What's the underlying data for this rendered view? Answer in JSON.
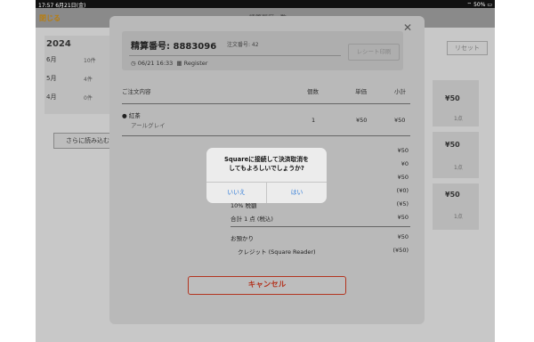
{
  "status": {
    "time": "17:57",
    "date": "6月21日(金)",
    "battery": "50%"
  },
  "header": {
    "close": "閉じる",
    "title": "精算履歴一覧"
  },
  "history": {
    "year": "2024",
    "months": [
      {
        "label": "6月",
        "count": "10件"
      },
      {
        "label": "5月",
        "count": "4件"
      },
      {
        "label": "4月",
        "count": "0件"
      }
    ],
    "load_more": "さらに読み込む",
    "reset": "リセット"
  },
  "right_cards": [
    {
      "amount": "¥50",
      "count": "1点"
    },
    {
      "amount": "¥50",
      "count": "1点"
    },
    {
      "amount": "¥50",
      "count": "1点"
    }
  ],
  "modal": {
    "title": "精算番号: 8883096",
    "order_no": "注文番号: 42",
    "datetime": "06/21 16:33",
    "register": "Register",
    "receipt_button": "レシート印刷",
    "columns": [
      "ご注文内容",
      "個数",
      "単価",
      "小計"
    ],
    "item": {
      "name": "紅茶",
      "variant": "アールグレイ",
      "qty": "1",
      "price": "¥50",
      "subtotal": "¥50"
    },
    "right_values": [
      "¥50",
      "¥0",
      "¥50",
      "(¥0)",
      "(¥5)",
      "¥50",
      "¥50",
      "(¥50)"
    ],
    "summary_labels": [
      "10% 税額",
      "合計 1 点 (税込)",
      "お預かり",
      "クレジット (Square Reader)"
    ],
    "cancel": "キャンセル"
  },
  "alert": {
    "message_line1": "Squareに接続して決済取消を",
    "message_line2": "してもよろしいでしょうか?",
    "no": "いいえ",
    "yes": "はい"
  }
}
